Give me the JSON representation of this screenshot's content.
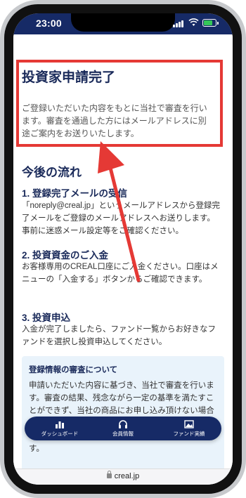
{
  "status_bar": {
    "time": "23:00"
  },
  "page": {
    "title": "投資家申請完了",
    "intro": "ご登録いただいた内容をもとに当社で審査を行います。審査を通過した方にはメールアドレスに別途ご案内をお送りいたします。",
    "flow_title": "今後の流れ",
    "steps": [
      {
        "title": "1. 登録完了メールの受信",
        "text": "「noreply@creal.jp」というメールアドレスから登録完了メールをご登録のメールアドレスへお送りします。事前に迷惑メール設定等をご確認ください。"
      },
      {
        "title": "2. 投資資金のご入金",
        "text": "お客様専用のCREAL口座にご入金ください。口座はメニューの「入金する」ボタンからご確認できます。"
      },
      {
        "title": "3. 投資申込",
        "text": "入金が完了しましたら、ファンド一覧からお好きなファンドを選択し投資申込してください。"
      }
    ],
    "notice": {
      "title": "登録情報の審査について",
      "text": "申請いただいた内容に基づき、当社で審査を行います。審査の結果、残念ながら一定の基準を満たすことができず、当社の商品にお申し込み頂けない場合もあります。審査結果が確定しましたら、メールにて通知をお送りします。その他ご案内を差し上げます。"
    }
  },
  "bottom_nav": {
    "items": [
      {
        "label": "ダッシュボード",
        "icon": "bar-chart-icon"
      },
      {
        "label": "会員情報",
        "icon": "headset-icon"
      },
      {
        "label": "ファンド実績",
        "icon": "image-icon"
      }
    ]
  },
  "browser": {
    "url": "creal.jp"
  },
  "colors": {
    "brand": "#162a66",
    "highlight": "#e53935",
    "notice_bg": "#e9f3fb"
  }
}
